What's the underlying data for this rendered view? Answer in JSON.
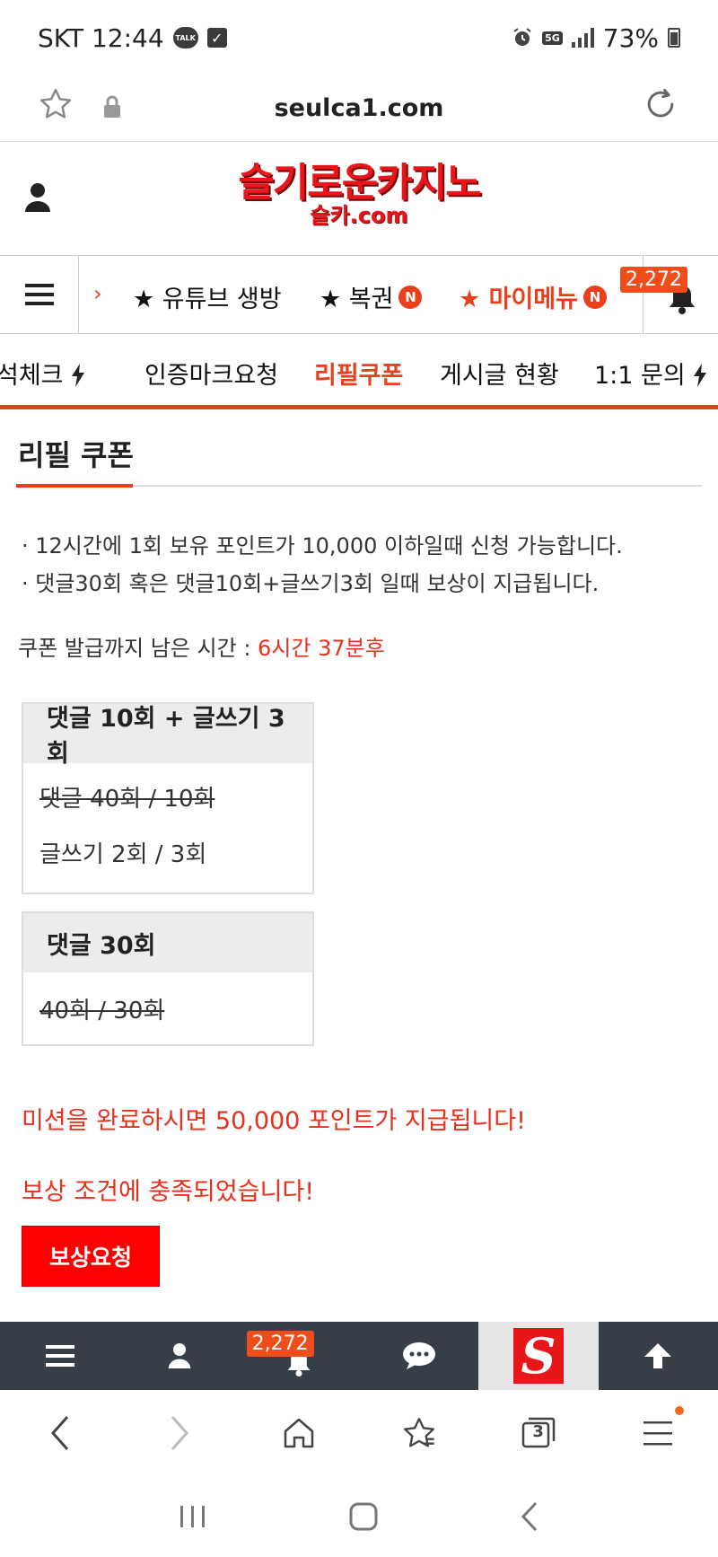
{
  "status_bar": {
    "carrier_time": "SKT 12:44",
    "talk_label": "TALK",
    "network": "5G",
    "battery": "73%"
  },
  "browser": {
    "url": "seulca1.com"
  },
  "site": {
    "logo_main": "슬기로운카지노",
    "logo_sub": "슬카.com"
  },
  "nav1": {
    "items": [
      {
        "label": "★ 유튜브 생방",
        "badge": ""
      },
      {
        "label": "★ 복권",
        "badge": "N"
      },
      {
        "label": "★ 마이메뉴",
        "badge": "N"
      }
    ],
    "bell_count": "2,272"
  },
  "nav2": {
    "items": [
      "석체크",
      "인증마크요청",
      "리필쿠폰",
      "게시글 현황",
      "1:1 문의"
    ]
  },
  "content": {
    "title": "리필 쿠폰",
    "notices": [
      "· 12시간에 1회 보유 포인트가 10,000 이하일때 신청 가능합니다.",
      "· 댓글30회 혹은 댓글10회+글쓰기3회 일때 보상이 지급됩니다."
    ],
    "remaining_label": "쿠폰 발급까지 남은 시간 : ",
    "remaining_value": "6시간 37분후",
    "mission1": {
      "header": "댓글 10회 + 글쓰기 3회",
      "row1": "댓글 40회 / 10회",
      "row2": "글쓰기 2회 / 3회"
    },
    "mission2": {
      "header": "댓글 30회",
      "row1": "40회 / 30회"
    },
    "complete_msg": "미션을 완료하시면 50,000 포인트가 지급됩니다!",
    "condition_msg": "보상 조건에 충족되었습니다!",
    "reward_button": "보상요청"
  },
  "site_bottom": {
    "bell_count": "2,272",
    "logo_letter": "S"
  },
  "browser_nav": {
    "tabs_count": "3"
  },
  "colors": {
    "accent": "#e8401c",
    "red": "#ff0000",
    "bottom_bar": "#363f48"
  }
}
